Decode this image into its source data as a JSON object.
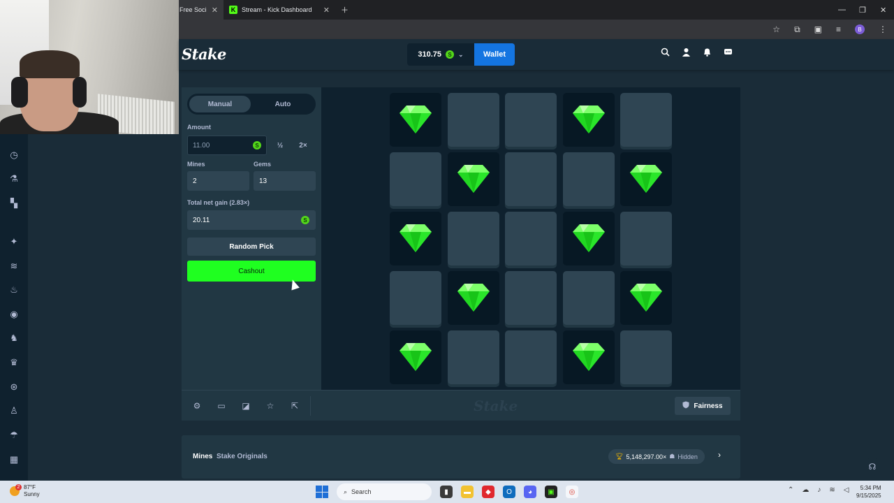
{
  "browser": {
    "tabs": [
      {
        "title": "Free Social"
      },
      {
        "title": "Stream - Kick Dashboard"
      }
    ],
    "profile_initial": "B"
  },
  "header": {
    "logo": "Stake",
    "balance": "310.75",
    "currency_icon": "S",
    "wallet_label": "Wallet"
  },
  "controls": {
    "mode_manual": "Manual",
    "mode_auto": "Auto",
    "amount_label": "Amount",
    "amount_value": "11.00",
    "half_label": "½",
    "double_label": "2×",
    "mines_label": "Mines",
    "mines_value": "2",
    "gems_label": "Gems",
    "gems_value": "13",
    "net_gain_label": "Total net gain (2.83×)",
    "net_gain_value": "20.11",
    "random_pick_label": "Random Pick",
    "cashout_label": "Cashout"
  },
  "board": {
    "rows": 5,
    "cols": 5,
    "tiles": [
      "gem",
      "hidden",
      "hidden",
      "gem",
      "hidden",
      "hidden",
      "gem",
      "hidden",
      "hidden",
      "gem",
      "gem",
      "hidden",
      "hidden",
      "gem",
      "hidden",
      "hidden",
      "gem",
      "hidden",
      "hidden",
      "gem",
      "gem",
      "hidden",
      "hidden",
      "gem",
      "hidden"
    ],
    "gem_color": "#2ae62a"
  },
  "footer": {
    "watermark": "Stake",
    "fairness_label": "Fairness"
  },
  "info": {
    "game_title": "Mines",
    "game_subtitle": "Stake Originals",
    "record_multiplier": "5,148,297.00×",
    "record_user": "Hidden"
  },
  "taskbar": {
    "weather_temp": "87°F",
    "weather_desc": "Sunny",
    "weather_badge": "2",
    "search_placeholder": "Search",
    "time": "5:34 PM",
    "date": "9/15/2025"
  },
  "colors": {
    "accent_green": "#1fff20",
    "wallet_blue": "#1475e1",
    "panel": "#213743",
    "board": "#0f212e"
  }
}
